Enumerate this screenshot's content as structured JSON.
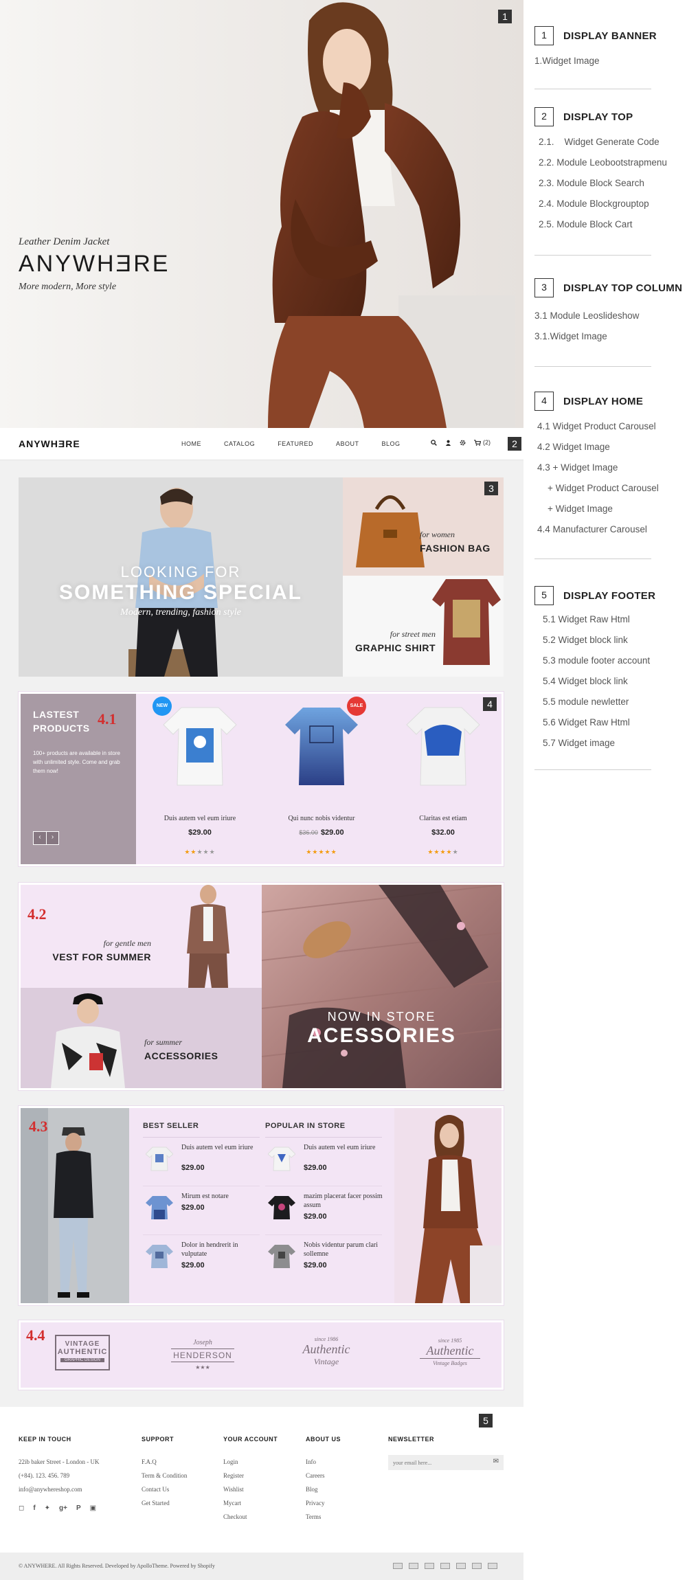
{
  "banner": {
    "subtitle": "Leather Denim Jacket",
    "title": "ANYWHƎRE",
    "tagline": "More modern, More style",
    "badge": "1"
  },
  "header": {
    "logo": "ANYWHƎRE",
    "nav": [
      "HOME",
      "CATALOG",
      "FEATURED",
      "ABOUT",
      "BLOG"
    ],
    "cart_count": "(2)",
    "badge": "2"
  },
  "slideshow": {
    "badge": "3",
    "main_line1": "LOOKING FOR",
    "main_line2": "SOMETHING SPECIAL",
    "main_line3": "Modern, trending, fashion style",
    "tile1_italic": "for women",
    "tile1_caption": "FASHION BAG",
    "tile2_italic": "for street men",
    "tile2_caption": "GRAPHIC SHIRT"
  },
  "carousel": {
    "badge": "4",
    "section_num": "4.1",
    "title": "LASTEST PRODUCTS",
    "description": "100+ products are available in store with unlimited style. Come and grab them now!",
    "prev": "‹",
    "next": "›",
    "products": [
      {
        "name": "Duis autem vel eum iriure",
        "price": "$29.00",
        "old_price": "",
        "flag": "NEW",
        "rating": 2
      },
      {
        "name": "Qui nunc nobis videntur",
        "price": "$29.00",
        "old_price": "$36.00",
        "flag": "SALE",
        "rating": 5
      },
      {
        "name": "Claritas est etiam",
        "price": "$32.00",
        "old_price": "",
        "flag": "",
        "rating": 4
      }
    ],
    "colors": {
      "new": "#2196f3",
      "sale": "#e53935"
    }
  },
  "widget42": {
    "section_num": "4.2",
    "tile1_italic": "for gentle men",
    "tile1_caption": "VEST FOR SUMMER",
    "tile2_italic": "for summer",
    "tile2_caption": "ACCESSORIES",
    "big_line1": "NOW IN STORE",
    "big_line2": "ACESSORIES"
  },
  "widget43": {
    "section_num": "4.3",
    "best_seller": {
      "title": "BEST SELLER",
      "items": [
        {
          "name": "Duis autem vel eum iriure",
          "price": "$29.00"
        },
        {
          "name": "Mirum est notare",
          "price": "$29.00"
        },
        {
          "name": "Dolor in hendrerit in vulputate",
          "price": "$29.00"
        }
      ]
    },
    "popular": {
      "title": "POPULAR IN STORE",
      "items": [
        {
          "name": "Duis autem vel eum iriure",
          "price": "$29.00"
        },
        {
          "name": "mazim placerat facer possim assum",
          "price": "$29.00"
        },
        {
          "name": "Nobis videntur parum clari sollemne",
          "price": "$29.00"
        }
      ]
    }
  },
  "manufacturers": {
    "section_num": "4.4",
    "brands": [
      {
        "line1": "VINTAGE",
        "line2": "AUTHENTIC",
        "line3": "GRAPHIC DESIGN"
      },
      {
        "line1": "Joseph",
        "line2": "HENDERSON",
        "line3": "★★★"
      },
      {
        "line1": "since 1986",
        "line2": "Authentic",
        "line3": "Vintage"
      },
      {
        "line1": "since 1985",
        "line2": "Authentic",
        "line3": "Vintage Badges"
      }
    ]
  },
  "footer": {
    "badge": "5",
    "keep_in_touch": {
      "title": "KEEP IN TOUCH",
      "lines": [
        "22ib baker Street - London - UK",
        "(+84). 123. 456. 789",
        "info@anywhereshop.com"
      ]
    },
    "support": {
      "title": "SUPPORT",
      "links": [
        "F.A.Q",
        "Term & Condition",
        "Contact Us",
        "Get Started"
      ]
    },
    "account": {
      "title": "YOUR ACCOUNT",
      "links": [
        "Login",
        "Register",
        "Wishlist",
        "Mycart",
        "Checkout"
      ]
    },
    "about": {
      "title": "ABOUT US",
      "links": [
        "Info",
        "Careers",
        "Blog",
        "Privacy",
        "Terms"
      ]
    },
    "newsletter": {
      "title": "NEWSLETTER",
      "placeholder": "your email here..."
    },
    "copyright": "© ANYWHERE. All Rights Reserved. Developed by ApolloTheme. Powered by Shopify"
  },
  "legend": {
    "sections": [
      {
        "num": "1",
        "title": "DISPLAY BANNER",
        "items": [
          "1.Widget Image"
        ]
      },
      {
        "num": "2",
        "title": "DISPLAY TOP",
        "items": [
          "2.1.    Widget Generate Code",
          "2.2. Module Leobootstrapmenu",
          "2.3. Module Block Search",
          "2.4. Module Blockgrouptop",
          "2.5. Module Block Cart"
        ]
      },
      {
        "num": "3",
        "title": "DISPLAY TOP COLUMN",
        "items": [
          "3.1 Module Leoslideshow",
          "3.1.Widget Image"
        ]
      },
      {
        "num": "4",
        "title": "DISPLAY HOME",
        "items": [
          "4.1 Widget Product Carousel",
          "4.2 Widget Image",
          "4.3 + Widget Image",
          "    + Widget Product Carousel",
          "    + Widget Image",
          "4.4 Manufacturer Carousel"
        ]
      },
      {
        "num": "5",
        "title": "DISPLAY FOOTER",
        "items": [
          "5.1 Widget Raw Html",
          "5.2 Widget block link",
          "5.3 module footer account",
          "5.4 Widget block link",
          "5.5 module newletter",
          "5.6 Widget Raw Html",
          "5.7 Widget image"
        ]
      }
    ]
  }
}
